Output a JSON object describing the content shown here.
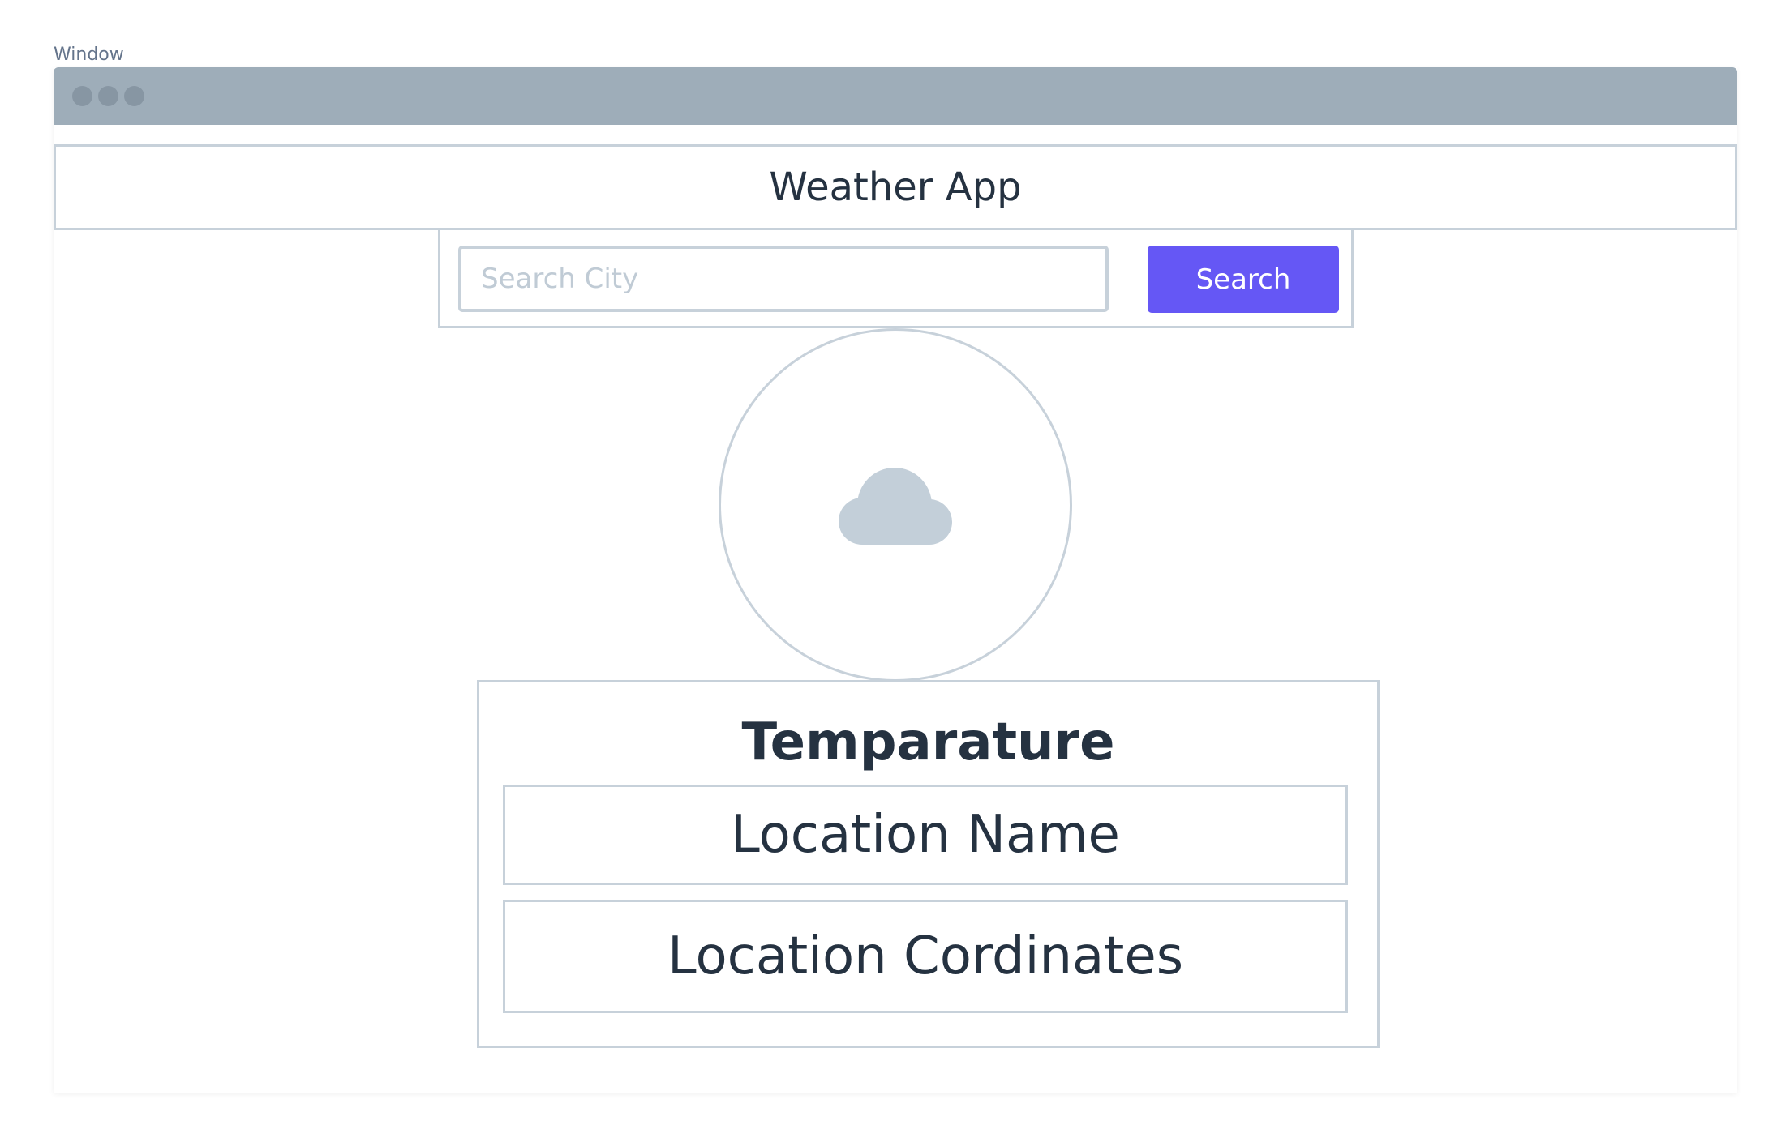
{
  "window": {
    "label": "Window"
  },
  "header": {
    "title": "Weather App"
  },
  "search": {
    "placeholder": "Search City",
    "value": "",
    "button_label": "Search"
  },
  "weather": {
    "icon": "cloud-icon",
    "temperature_label": "Temparature",
    "location_name_label": "Location Name",
    "location_coordinates_label": "Location Cordinates"
  },
  "colors": {
    "accent": "#6557f5",
    "titlebar": "#9eadb9",
    "border": "#c7d1da",
    "text": "#253241",
    "icon": "#c3cfd9"
  }
}
